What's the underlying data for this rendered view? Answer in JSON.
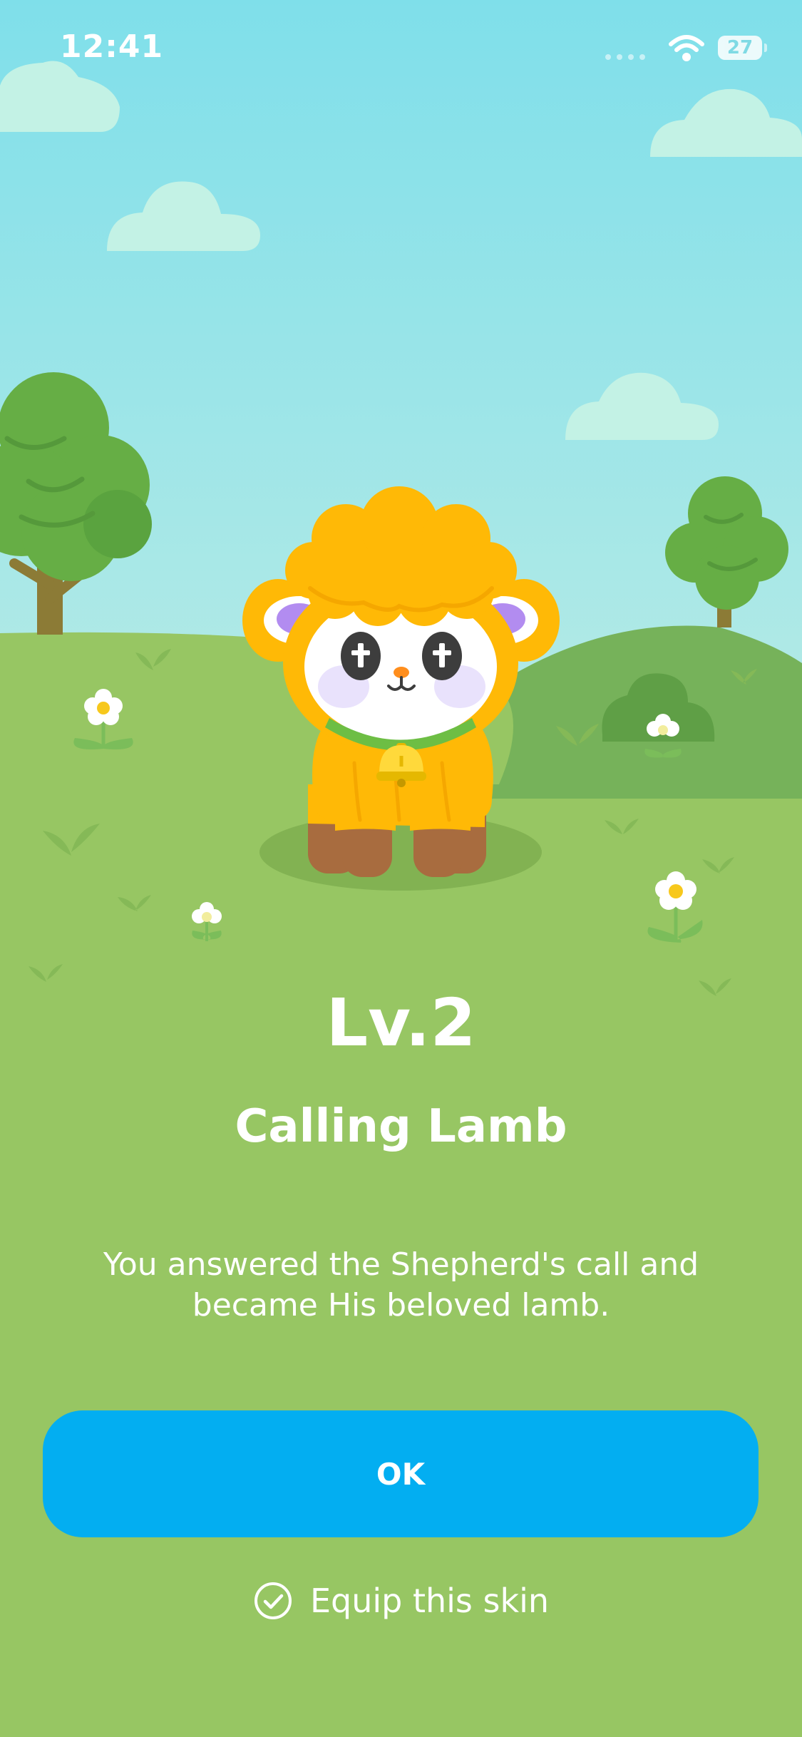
{
  "status_bar": {
    "time": "12:41",
    "battery": "27"
  },
  "reward": {
    "level": "Lv.2",
    "skin_name": "Calling Lamb",
    "description_line1": "You answered the Shepherd's call and",
    "description_line2": "became His beloved lamb."
  },
  "actions": {
    "ok_label": "OK",
    "equip_label": "Equip this skin",
    "equip_checked": true
  },
  "colors": {
    "sky_top": "#7fdfea",
    "sky_bottom": "#b3eae6",
    "grass": "#97c663",
    "lamb_wool": "#ffb906",
    "button": "#03aef1"
  },
  "icons": [
    "wifi-icon",
    "battery-icon",
    "check-circle-icon",
    "cross-icon",
    "bell-icon",
    "flower-icon"
  ]
}
